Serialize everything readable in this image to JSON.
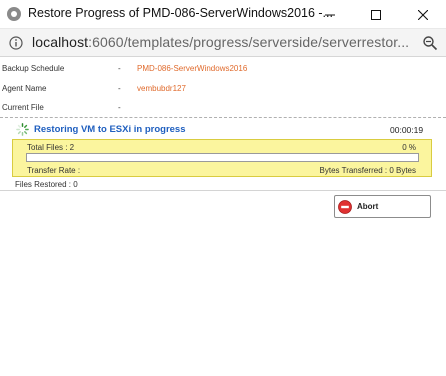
{
  "window": {
    "title": "Restore Progress of PMD-086-ServerWindows2016 -...",
    "controls": [
      "minimize",
      "maximize",
      "close"
    ]
  },
  "addressbar": {
    "url_host": "localhost",
    "url_path": ":6060/templates/progress/serverside/serverrestor...",
    "icons": [
      "info-icon",
      "zoom-icon"
    ]
  },
  "details": {
    "separator": "-",
    "backup_schedule": {
      "label": "Backup Schedule",
      "value": "PMD-086-ServerWindows2016"
    },
    "agent_name": {
      "label": "Agent Name",
      "value": "vembubdr127"
    },
    "current_file": {
      "label": "Current File",
      "value": ""
    }
  },
  "status": {
    "title": "Restoring VM to ESXi in progress",
    "elapsed": "00:00:19",
    "icon": "spinner-icon"
  },
  "progress": {
    "total_files": "Total Files : 2",
    "percent_text": "0 %",
    "fraction": 0,
    "transfer_rate": "Transfer Rate :",
    "bytes_transferred": "Bytes Transferred : 0 Bytes"
  },
  "files_restored": "Files Restored : 0",
  "actions": {
    "abort_label": "Abort",
    "abort_icon": "stop-icon"
  },
  "colors": {
    "accent_value": "#e06a2c",
    "status_title": "#1f5fbf",
    "progress_box": "#fbf59e",
    "abort_icon": "#e03131"
  }
}
